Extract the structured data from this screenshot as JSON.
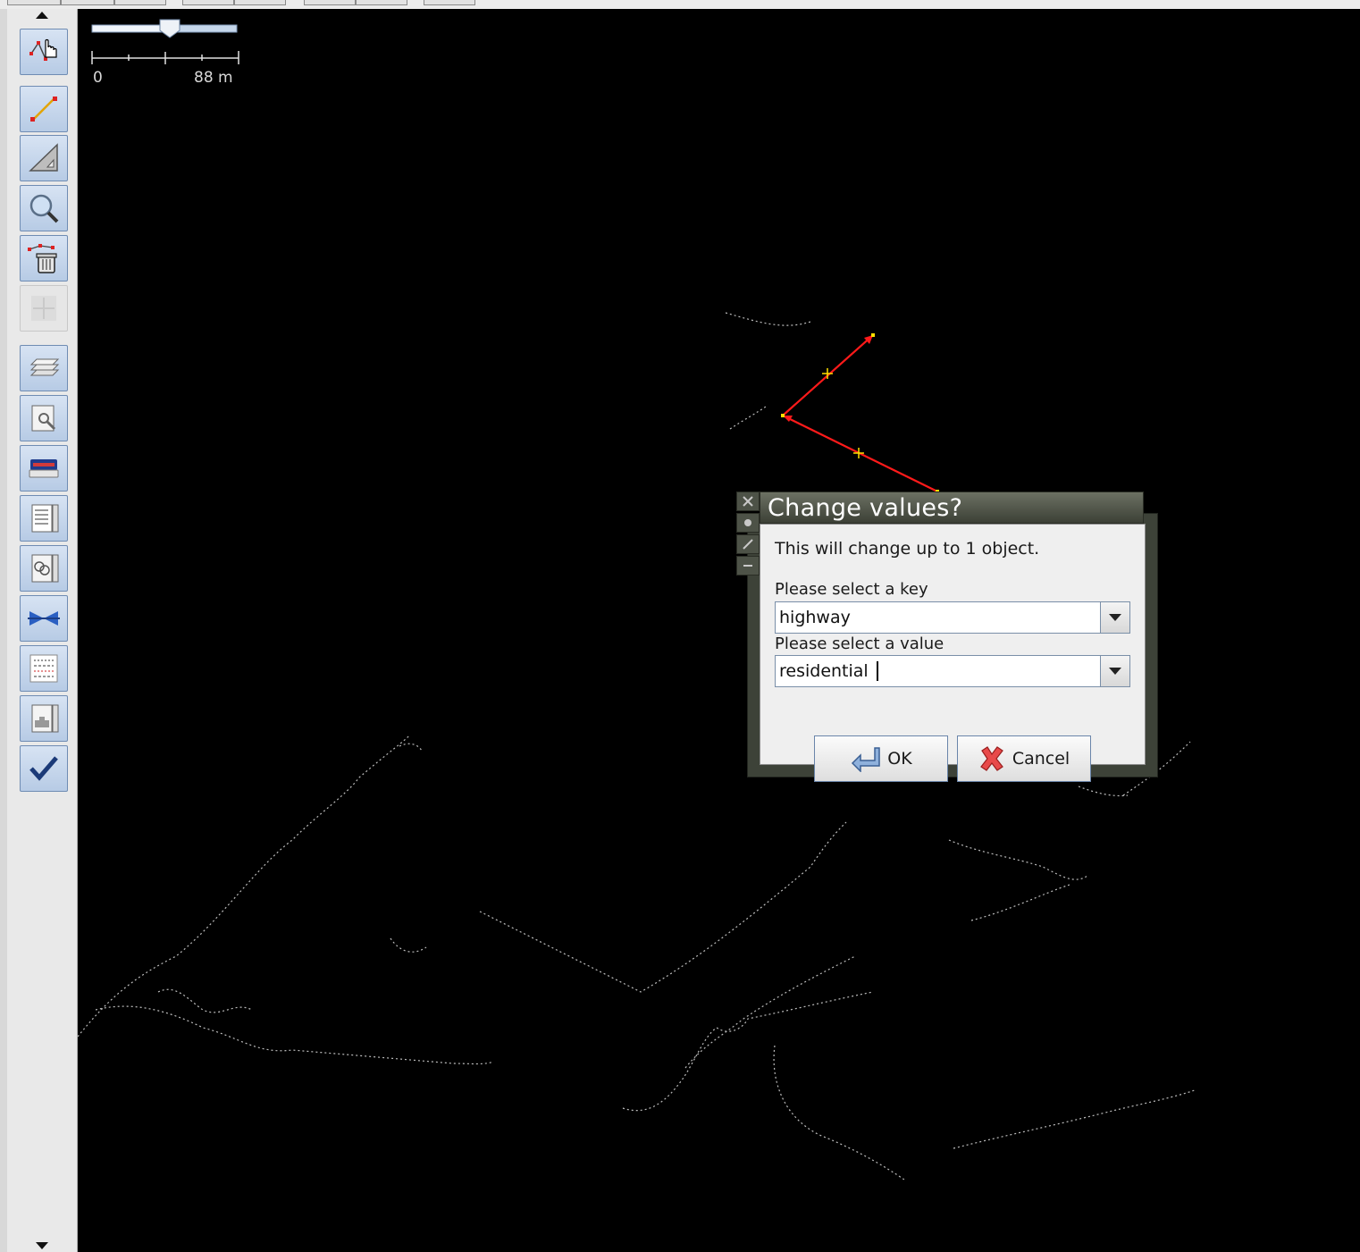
{
  "map": {
    "scale_start": "0",
    "scale_end": "88 m"
  },
  "dialog": {
    "title": "Change values?",
    "message": "This will change up to 1 object.",
    "key_label": "Please select a key",
    "key_value": "highway",
    "value_label": "Please select a value",
    "value_value": "residential",
    "ok_label": "OK",
    "cancel_label": "Cancel"
  },
  "toolbar": {
    "tools": [
      "select-tool-icon",
      "draw-tool-icon",
      "measure-tool-icon",
      "zoom-tool-icon",
      "delete-tool-icon",
      "parallel-tool-icon",
      "layers-icon",
      "properties-icon",
      "imagery-icon",
      "relations-icon",
      "selection-list-icon",
      "conflict-icon",
      "history-icon",
      "filter-icon",
      "validate-icon"
    ]
  },
  "colors": {
    "map_background": "#000000",
    "selected_way": "#ff0000",
    "node": "#ffe000",
    "dialog_frame": "#3d4238",
    "toolbar_button": "#c6d6ec"
  }
}
